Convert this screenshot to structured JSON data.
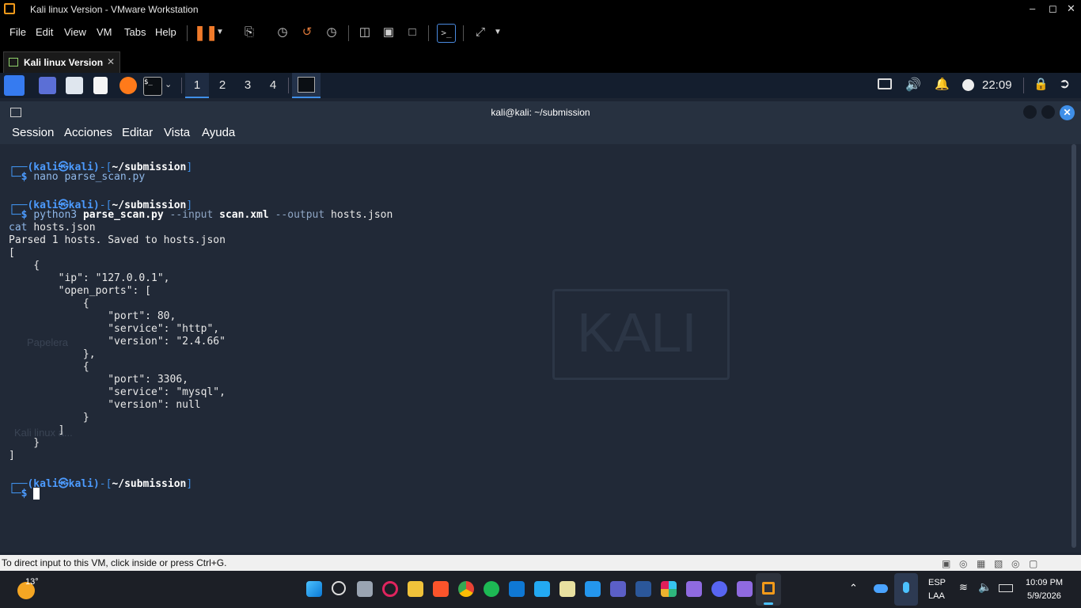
{
  "vmware": {
    "window_title": "Kali linux Version - VMware Workstation",
    "menu": [
      "File",
      "Edit",
      "View",
      "VM",
      "Tabs",
      "Help"
    ],
    "tab_label": "Kali linux Version",
    "status_text": "To direct input to this VM, click inside or press Ctrl+G."
  },
  "kali_panel": {
    "workspaces": [
      "1",
      "2",
      "3",
      "4"
    ],
    "clock": "22:09"
  },
  "terminal": {
    "title": "kali@kali: ~/submission",
    "menu": [
      "Session",
      "Acciones",
      "Editar",
      "Vista",
      "Ayuda"
    ],
    "prompt_user": "(kali㉿kali)",
    "prompt_dir": "~/submission",
    "cmd1": "nano parse_scan.py",
    "cmd2_prog": "python3",
    "cmd2_script": "parse_scan.py",
    "cmd2_opt1": "--input",
    "cmd2_arg1": "scan.xml",
    "cmd2_opt2": "--output",
    "cmd2_arg2": "hosts.json",
    "cat_cmd": "cat",
    "cat_arg": "hosts.json",
    "output_lines": [
      "Parsed 1 hosts. Saved to hosts.json",
      "[",
      "    {",
      "        \"ip\": \"127.0.0.1\",",
      "        \"open_ports\": [",
      "            {",
      "                \"port\": 80,",
      "                \"service\": \"http\",",
      "                \"version\": \"2.4.66\"",
      "            },",
      "            {",
      "                \"port\": 3306,",
      "                \"service\": \"mysql\",",
      "                \"version\": null",
      "            }",
      "        ]",
      "    }",
      "]"
    ]
  },
  "desktop": {
    "icons": [
      "Papelera",
      "Kali linux a..."
    ],
    "wallpaper_text": "KALI"
  },
  "windows_taskbar": {
    "weather": "13°",
    "lang_top": "ESP",
    "lang_bottom": "LAA",
    "time": "10:09 PM",
    "date": "5/9/2026"
  }
}
